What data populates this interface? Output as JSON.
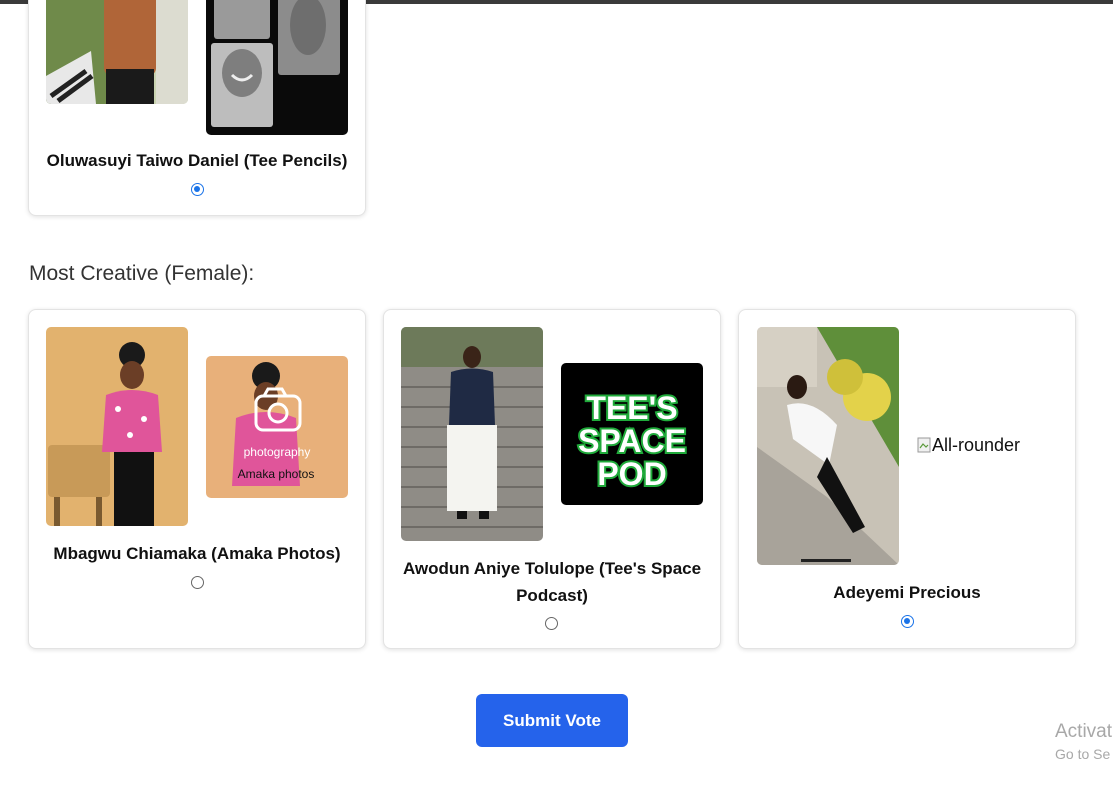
{
  "male_nominee": {
    "name": "Oluwasuyi Taiwo Daniel (Tee Pencils)",
    "selected": true
  },
  "female_section": {
    "title": "Most Creative (Female):",
    "nominees": [
      {
        "name": "Mbagwu Chiamaka (Amaka Photos)",
        "selected": false,
        "flyer_text_1": "photography",
        "flyer_text_2": "Amaka photos"
      },
      {
        "name": "Awodun Aniye Tolulope (Tee's Space Podcast)",
        "selected": false,
        "logo_line_1": "TEE'S",
        "logo_line_2": "SPACE",
        "logo_line_3": "POD"
      },
      {
        "name": "Adeyemi Precious",
        "selected": true,
        "broken_image_alt": "All-rounder"
      }
    ]
  },
  "submit_label": "Submit Vote",
  "watermark": {
    "line1": "Activat",
    "line2": "Go to Se"
  },
  "colors": {
    "accent": "#2563eb",
    "radio_checked": "#1a73e8",
    "podcast_green": "#1faa3a"
  }
}
